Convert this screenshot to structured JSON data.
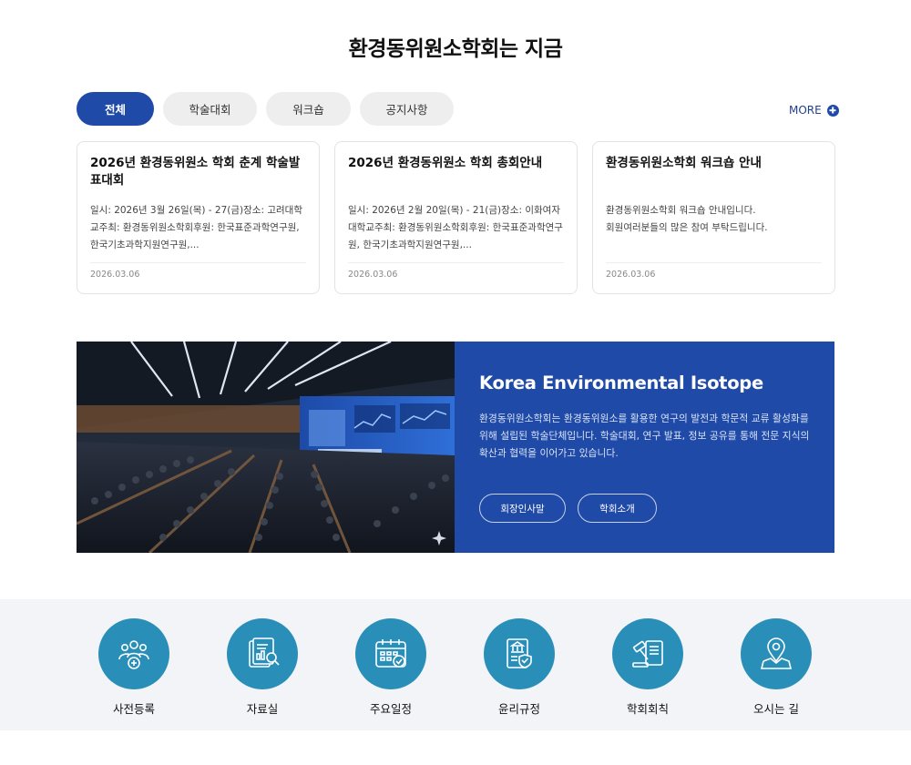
{
  "section": {
    "title": "환경동위원소학회는 지금"
  },
  "tabs": [
    {
      "label": "전체",
      "active": true
    },
    {
      "label": "학술대회",
      "active": false
    },
    {
      "label": "워크숍",
      "active": false
    },
    {
      "label": "공지사항",
      "active": false
    }
  ],
  "more": {
    "label": "MORE",
    "icon": "plus-circle-icon"
  },
  "cards": [
    {
      "title": "2026년 환경동위원소 학회 춘계 학술발표대회",
      "body": "일시: 2026년 3월 26일(목) - 27(금)장소: 고려대학교주최: 환경동위원소학회후원: 한국표준과학연구원, 한국기초과학지원연구원,...",
      "date": "2026.03.06"
    },
    {
      "title": "2026년 환경동위원소 학회 총회안내",
      "body": "일시: 2026년 2월 20일(목) - 21(금)장소: 이화여자대학교주최: 환경동위원소학회후원: 한국표준과학연구원, 한국기초과학지원연구원,...",
      "date": "2026.03.06"
    },
    {
      "title": "환경동위원소학회 워크숍 안내",
      "body": "환경동위원소학회 워크숍 안내입니다.\n회원여러분들의 많은 참여 부탁드립니다.",
      "date": "2026.03.06"
    }
  ],
  "banner": {
    "title": "Korea Environmental Isotope",
    "description": "환경동위원소학회는 환경동위원소를 활용한 연구의 발전과 학문적 교류 활성화를 위해 설립된 학술단체입니다.  학술대회, 연구 발표, 정보 공유를 통해 전문 지식의 확산과 협력을 이어가고 있습니다.",
    "buttons": [
      "회장인사말",
      "학회소개"
    ],
    "accent": "#1f4aa8"
  },
  "quick_links": [
    {
      "label": "사전등록",
      "icon": "people-add-icon"
    },
    {
      "label": "자료실",
      "icon": "documents-search-icon"
    },
    {
      "label": "주요일정",
      "icon": "calendar-icon"
    },
    {
      "label": "윤리규정",
      "icon": "regulation-document-icon"
    },
    {
      "label": "학회회칙",
      "icon": "gavel-document-icon"
    },
    {
      "label": "오시는 길",
      "icon": "map-pin-icon"
    }
  ],
  "colors": {
    "primary": "#1f4aa8",
    "quick_circle": "#2a8fb8",
    "quick_bg": "#f2f4f8"
  }
}
